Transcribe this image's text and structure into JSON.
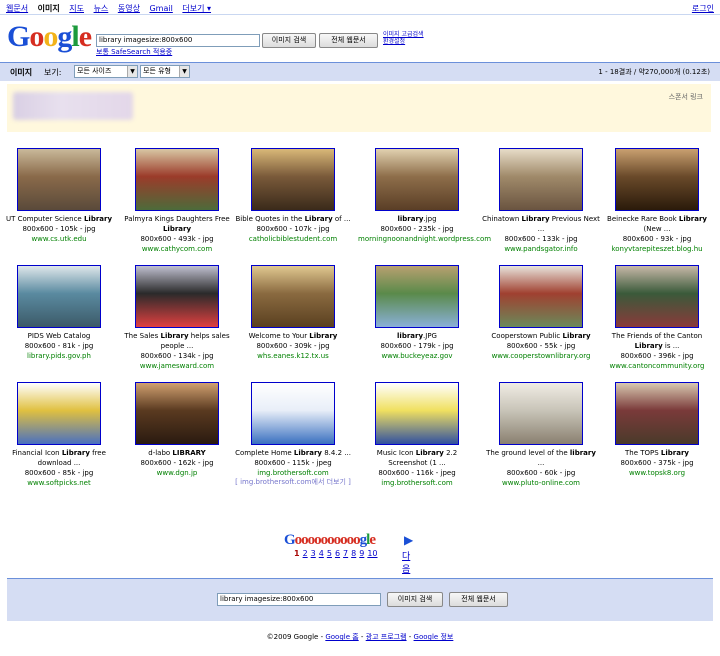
{
  "nav": {
    "items": [
      "웹문서",
      "이미지",
      "지도",
      "뉴스",
      "동영상",
      "Gmail",
      "더보기 ▾"
    ],
    "login": "로그인"
  },
  "logo": "Google",
  "search": {
    "query": "library imagesize:800x600",
    "btn_images": "이미지 검색",
    "btn_web": "전체 웹문서",
    "advanced": "이미지 고급검색",
    "settings": "환경설정",
    "safesearch": "보통 SafeSearch 적용중"
  },
  "bar": {
    "title": "이미지",
    "see": "보기:",
    "size_select": "모든 사이즈",
    "type_select": "모든 유형",
    "stats": "1 - 18결과 / 약270,000개 (0.12초)"
  },
  "ad": {
    "label": "스폰서 링크"
  },
  "results": [
    {
      "pre": "UT Computer Science ",
      "bold": "Library",
      "post": "",
      "meta": "800x600 - 105k - jpg",
      "domain": "www.cs.utk.edu"
    },
    {
      "pre": "Palmyra Kings Daughters Free ",
      "bold": "Library",
      "post": "",
      "meta": "800x600 - 493k - jpg",
      "domain": "www.cathycom.com"
    },
    {
      "pre": "Bible Quotes in the ",
      "bold": "Library",
      "post": " of ...",
      "meta": "800x600 - 107k - jpg",
      "domain": "catholicbiblestudent.com"
    },
    {
      "pre": "",
      "bold": "library",
      "post": ".jpg",
      "meta": "800x600 - 235k - jpg",
      "domain": "morningnoonandnight.wordpress.com"
    },
    {
      "pre": "Chinatown ",
      "bold": "Library",
      "post": " Previous Next ...",
      "meta": "800x600 - 133k - jpg",
      "domain": "www.pandsgator.info"
    },
    {
      "pre": "Beinecke Rare Book ",
      "bold": "Library",
      "post": " (New ...",
      "meta": "800x600 - 93k - jpg",
      "domain": "konyvtarepiteszet.blog.hu"
    },
    {
      "pre": "PIDS Web Catalog",
      "bold": "",
      "post": "",
      "meta": "800x600 - 81k - jpg",
      "domain": "library.pids.gov.ph"
    },
    {
      "pre": "The Sales ",
      "bold": "Library",
      "post": " helps sales people ...",
      "meta": "800x600 - 134k - jpg",
      "domain": "www.jamesward.com"
    },
    {
      "pre": "Welcome to Your ",
      "bold": "Library",
      "post": "",
      "meta": "800x600 - 309k - jpg",
      "domain": "whs.eanes.k12.tx.us"
    },
    {
      "pre": "",
      "bold": "library",
      "post": ".JPG",
      "meta": "800x600 - 179k - jpg",
      "domain": "www.buckeyeaz.gov"
    },
    {
      "pre": "Cooperstown Public ",
      "bold": "Library",
      "post": "",
      "meta": "800x600 - 55k - jpg",
      "domain": "www.cooperstownlibrary.org"
    },
    {
      "pre": "The Friends of the Canton ",
      "bold": "Library",
      "post": " is ...",
      "meta": "800x600 - 396k - jpg",
      "domain": "www.cantoncommunity.org"
    },
    {
      "pre": "Financial Icon ",
      "bold": "Library",
      "post": " free download ...",
      "meta": "800x600 - 85k - jpg",
      "domain": "www.softpicks.net"
    },
    {
      "pre": "d-labo ",
      "bold": "LIBRARY",
      "post": "",
      "meta": "800x600 - 162k - jpg",
      "domain": "www.dgn.jp"
    },
    {
      "pre": "Complete Home ",
      "bold": "Library",
      "post": " 8.4.2 ...",
      "meta": "800x600 - 115k - jpeg",
      "domain": "img.brothersoft.com",
      "more": "[ img.brothersoft.com에서 더보기 ]"
    },
    {
      "pre": "Music Icon ",
      "bold": "Library",
      "post": " 2.2 Screenshot (1 ...",
      "meta": "800x600 - 116k - jpeg",
      "domain": "img.brothersoft.com"
    },
    {
      "pre": "The ground level of the ",
      "bold": "library",
      "post": " ...",
      "meta": "800x600 - 60k - jpg",
      "domain": "www.pluto-online.com"
    },
    {
      "pre": "The TOPS ",
      "bold": "Library",
      "post": "",
      "meta": "800x600 - 375k - jpg",
      "domain": "www.topsk8.org"
    }
  ],
  "pager": {
    "logo": "Gooooooooooogle",
    "pages": [
      "1",
      "2",
      "3",
      "4",
      "5",
      "6",
      "7",
      "8",
      "9",
      "10"
    ],
    "next": "다음"
  },
  "bottom": {
    "query": "library imagesize:800x600",
    "btn_images": "이미지 검색",
    "btn_web": "전체 웹문서"
  },
  "footer": {
    "copy": "©2009 Google - ",
    "home": "Google 홈",
    "ads": "광고 프로그램",
    "about": "Google 정보",
    "sep": " - "
  }
}
